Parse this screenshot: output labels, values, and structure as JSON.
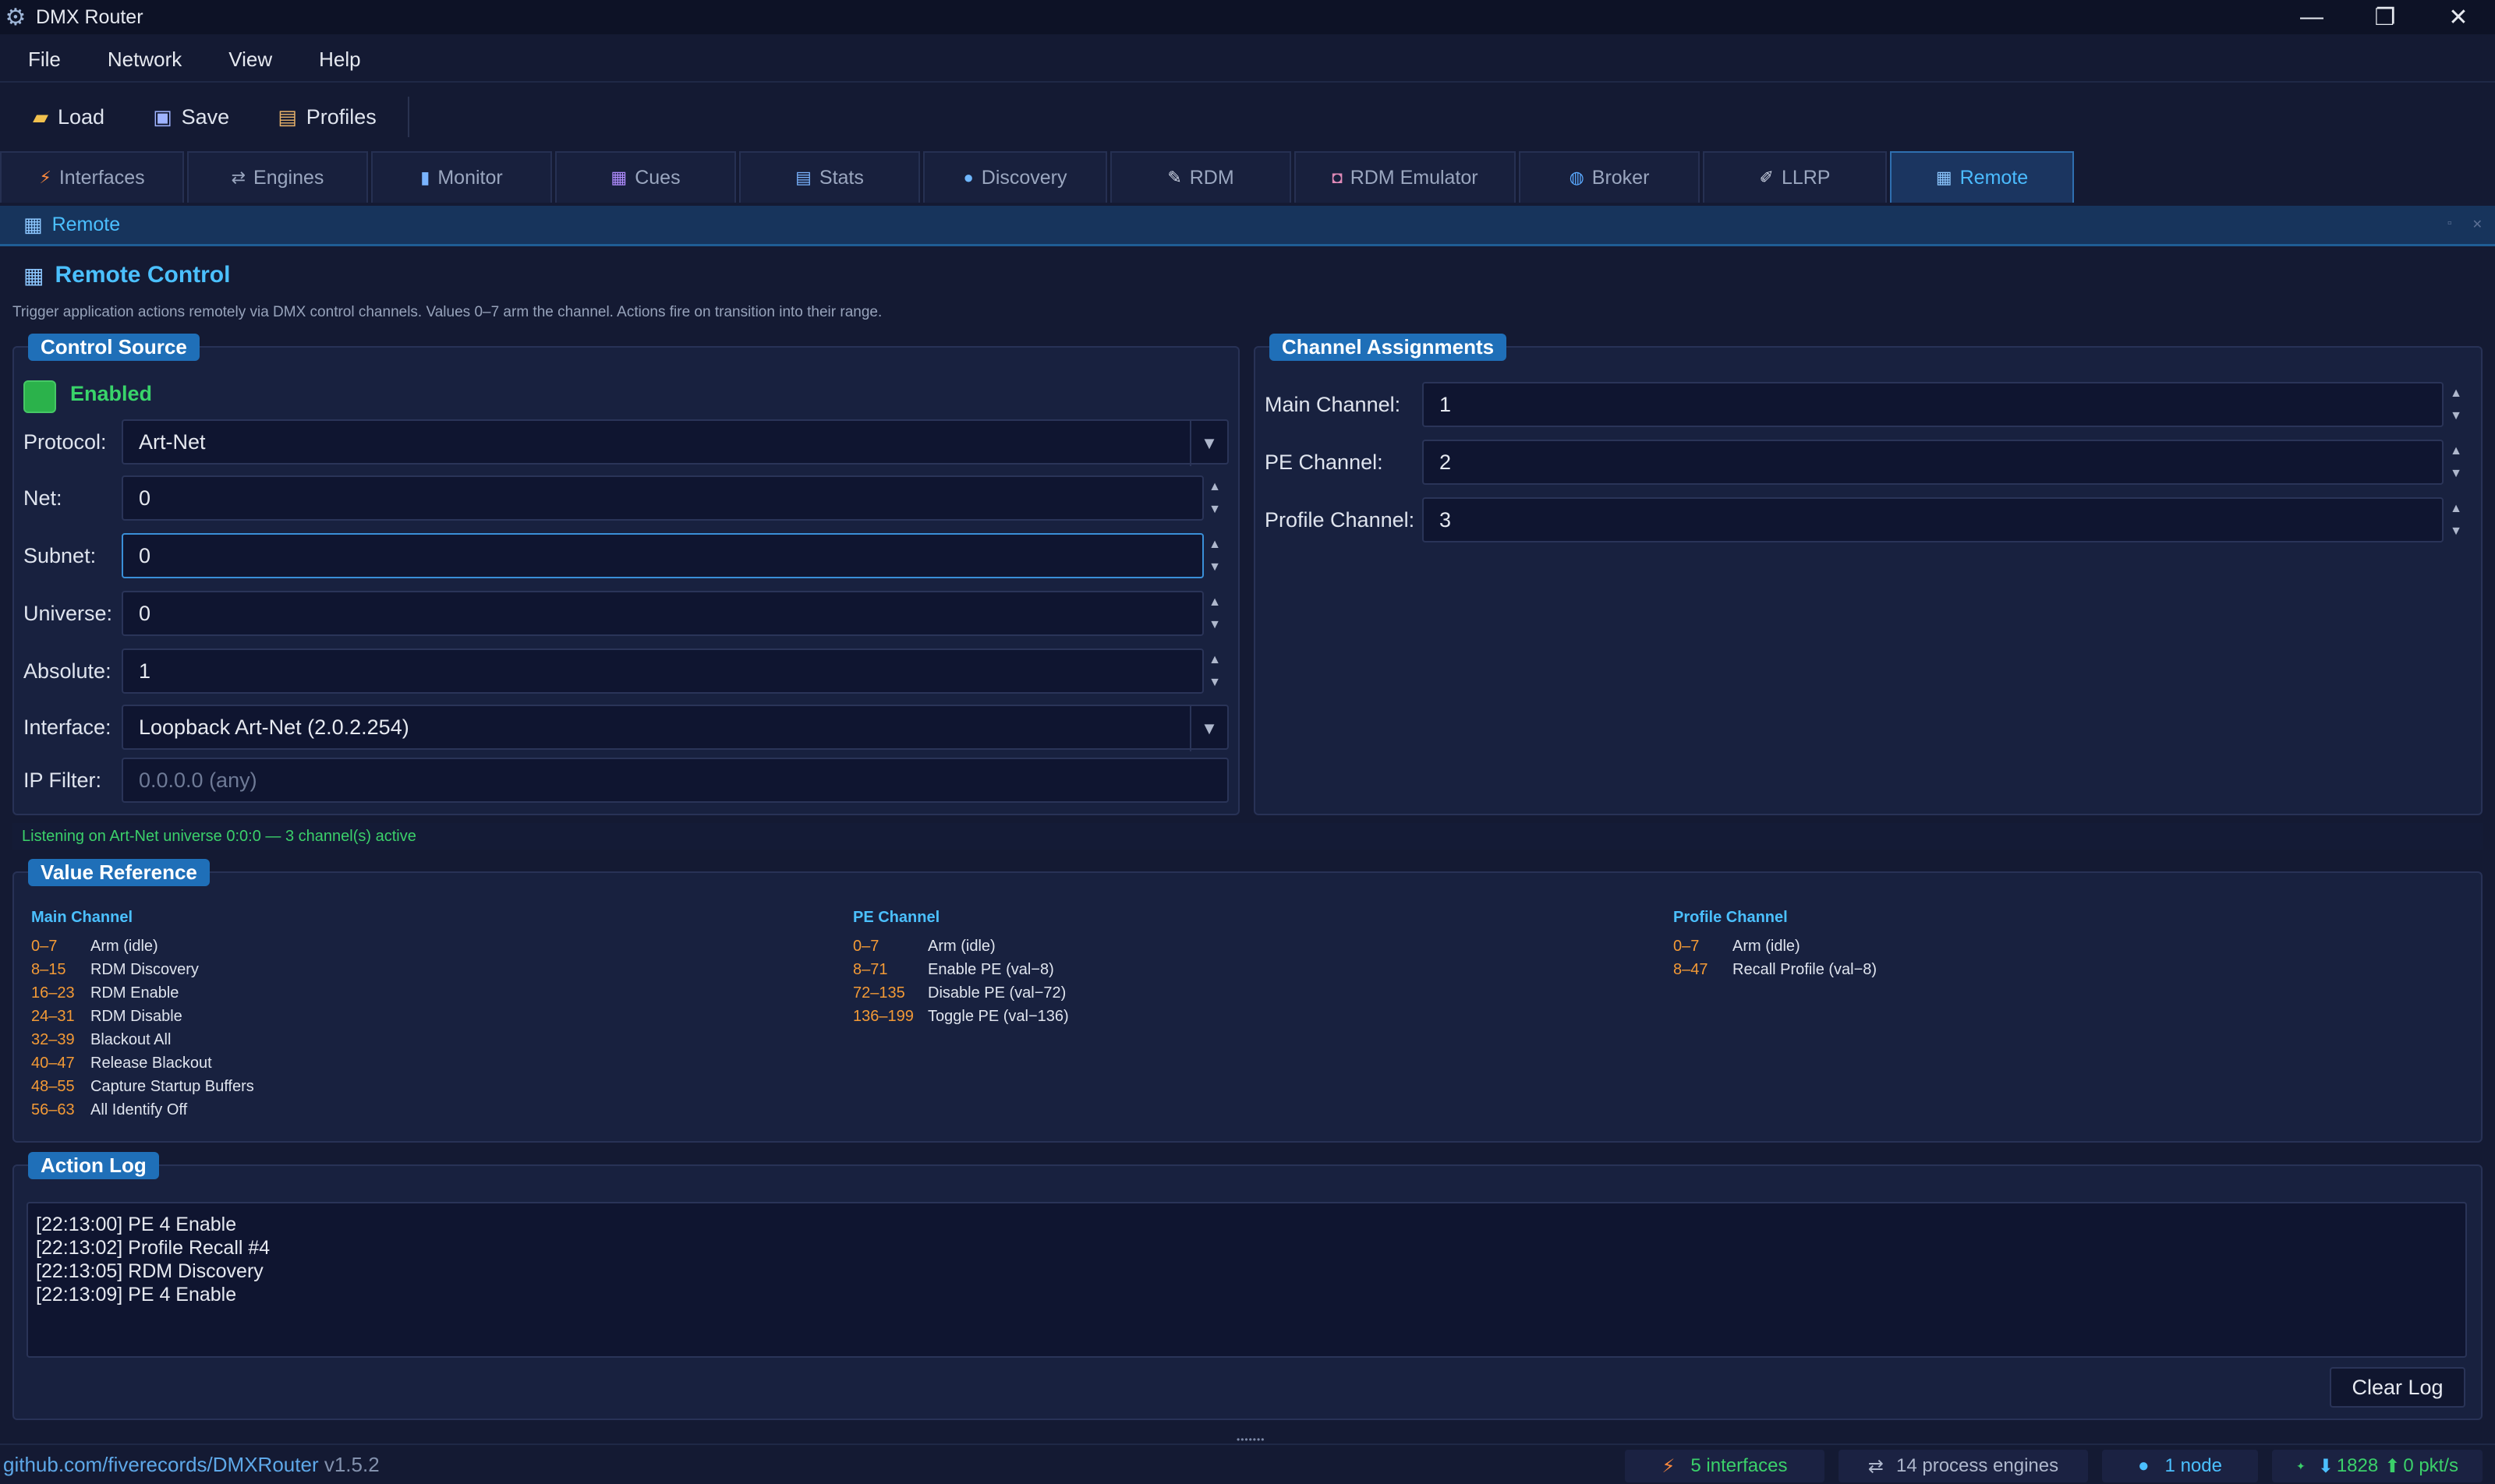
{
  "window": {
    "title": "DMX Router",
    "minimize": "—",
    "maximize": "❐",
    "close": "✕"
  },
  "menu": [
    "File",
    "Network",
    "View",
    "Help"
  ],
  "toolbar": {
    "load": "Load",
    "save": "Save",
    "profiles": "Profiles"
  },
  "tabs": [
    {
      "label": "Interfaces",
      "icon": "⚡"
    },
    {
      "label": "Engines",
      "icon": "⇄"
    },
    {
      "label": "Monitor",
      "icon": "▮"
    },
    {
      "label": "Cues",
      "icon": "▦"
    },
    {
      "label": "Stats",
      "icon": "▤"
    },
    {
      "label": "Discovery",
      "icon": "●"
    },
    {
      "label": "RDM",
      "icon": "✎"
    },
    {
      "label": "RDM Emulator",
      "icon": "◘"
    },
    {
      "label": "Broker",
      "icon": "◍"
    },
    {
      "label": "LLRP",
      "icon": "✐"
    },
    {
      "label": "Remote",
      "icon": "▦"
    }
  ],
  "panel": {
    "title": "Remote"
  },
  "remote": {
    "title": "Remote Control",
    "description": "Trigger application actions remotely via DMX control channels. Values 0–7 arm the channel. Actions fire on transition into their range."
  },
  "control_source": {
    "label": "Control Source",
    "enabled_label": "Enabled",
    "protocol_label": "Protocol:",
    "protocol": "Art-Net",
    "net_label": "Net:",
    "net": "0",
    "subnet_label": "Subnet:",
    "subnet": "0",
    "universe_label": "Universe:",
    "universe": "0",
    "absolute_label": "Absolute:",
    "absolute": "1",
    "interface_label": "Interface:",
    "interface": "Loopback Art-Net (2.0.2.254)",
    "ip_filter_label": "IP Filter:",
    "ip_filter_placeholder": "0.0.0.0 (any)"
  },
  "channel_assignments": {
    "label": "Channel Assignments",
    "main_label": "Main Channel:",
    "main": "1",
    "pe_label": "PE Channel:",
    "pe": "2",
    "profile_label": "Profile Channel:",
    "profile": "3"
  },
  "status": "Listening on Art-Net universe 0:0:0 — 3 channel(s) active",
  "value_reference": {
    "label": "Value Reference",
    "main": {
      "title": "Main Channel",
      "items": [
        {
          "range": "0–7",
          "desc": "Arm (idle)"
        },
        {
          "range": "8–15",
          "desc": "RDM Discovery"
        },
        {
          "range": "16–23",
          "desc": "RDM Enable"
        },
        {
          "range": "24–31",
          "desc": "RDM Disable"
        },
        {
          "range": "32–39",
          "desc": "Blackout All"
        },
        {
          "range": "40–47",
          "desc": "Release Blackout"
        },
        {
          "range": "48–55",
          "desc": "Capture Startup Buffers"
        },
        {
          "range": "56–63",
          "desc": "All Identify Off"
        }
      ]
    },
    "pe": {
      "title": "PE Channel",
      "items": [
        {
          "range": "0–7",
          "desc": "Arm (idle)"
        },
        {
          "range": "8–71",
          "desc": "Enable PE (val−8)"
        },
        {
          "range": "72–135",
          "desc": "Disable PE (val−72)"
        },
        {
          "range": "136–199",
          "desc": "Toggle PE (val−136)"
        }
      ]
    },
    "profile": {
      "title": "Profile Channel",
      "items": [
        {
          "range": "0–7",
          "desc": "Arm (idle)"
        },
        {
          "range": "8–47",
          "desc": "Recall Profile (val−8)"
        }
      ]
    }
  },
  "action_log": {
    "label": "Action Log",
    "lines": [
      "[22:13:00] PE 4 Enable",
      "[22:13:02] Profile Recall #4",
      "[22:13:05] RDM Discovery",
      "[22:13:09] PE 4 Enable"
    ],
    "clear_label": "Clear Log"
  },
  "statusbar": {
    "link": "github.com/fiverecords/DMXRouter",
    "version": "v1.5.2",
    "interfaces": "5 interfaces",
    "engines": "14 process engines",
    "nodes": "1 node",
    "rx": "1828",
    "tx": "0 pkt/s"
  },
  "colors": {
    "accent": "#4bc0ff",
    "range": "#f39a36",
    "ok": "#39d46a"
  }
}
